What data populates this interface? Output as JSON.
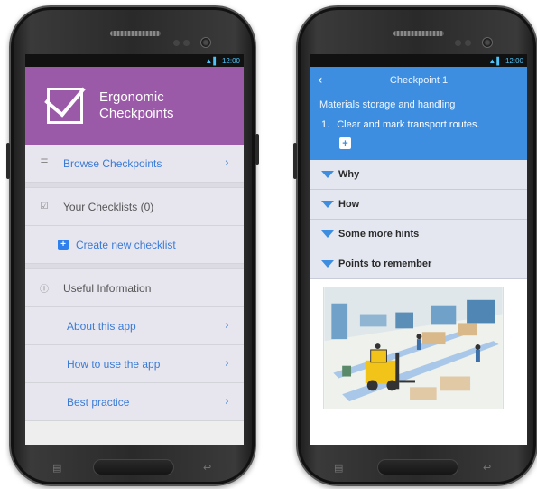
{
  "left_phone": {
    "status": {
      "time": "12:00"
    },
    "header": {
      "title_line1": "Ergonomic",
      "title_line2": "Checkpoints",
      "color": "#9b5aa8"
    },
    "menu": {
      "browse": {
        "label": "Browse Checkpoints",
        "icon": "list-icon"
      },
      "checklists": {
        "label": "Your Checklists (0)",
        "icon": "checkbox-icon"
      },
      "create": {
        "label": "Create new checklist",
        "icon": "plus-icon"
      },
      "useful": {
        "label": "Useful Information",
        "icon": "info-icon"
      },
      "about": {
        "label": "About this app"
      },
      "howto": {
        "label": "How to use the app"
      },
      "best": {
        "label": "Best practice"
      }
    }
  },
  "right_phone": {
    "status": {
      "time": "12:00"
    },
    "nav": {
      "title": "Checkpoint 1",
      "back_icon": "chevron-left-icon"
    },
    "checkpoint": {
      "category": "Materials storage and handling",
      "number": "1.",
      "text": "Clear and mark transport routes.",
      "accent": "#3d8ee0"
    },
    "sections": [
      "Why",
      "How",
      "Some more hints",
      "Points to remember"
    ]
  }
}
